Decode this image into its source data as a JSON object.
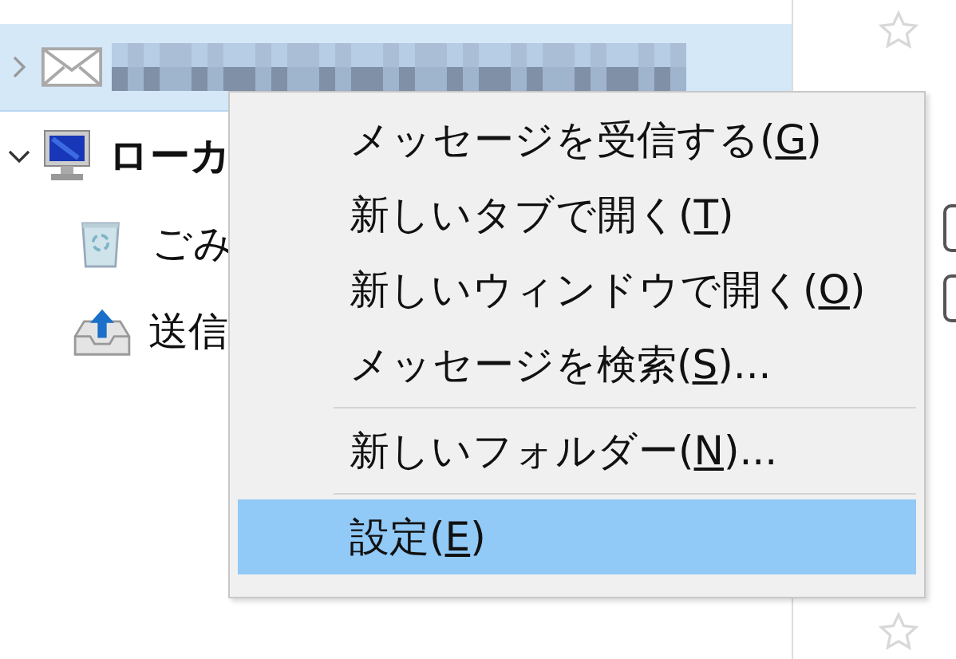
{
  "folder_tree": [
    {
      "kind": "account",
      "expanded": false,
      "selected": true
    },
    {
      "kind": "local",
      "label": "ローカ",
      "expanded": true,
      "selected": false,
      "children": [
        {
          "kind": "trash",
          "label": "ごみ",
          "selected": false
        },
        {
          "kind": "outbox",
          "label": "送信",
          "selected": false
        }
      ]
    }
  ],
  "context_menu": {
    "items": [
      {
        "kind": "item",
        "label": "メッセージを受信する(",
        "key": "G",
        "suffix": ")",
        "selected": false
      },
      {
        "kind": "item",
        "label": "新しいタブで開く(",
        "key": "T",
        "suffix": ")",
        "selected": false
      },
      {
        "kind": "item",
        "label": "新しいウィンドウで開く(",
        "key": "O",
        "suffix": ")",
        "selected": false
      },
      {
        "kind": "item",
        "label": "メッセージを検索(",
        "key": "S",
        "suffix": ")...",
        "selected": false
      },
      {
        "kind": "separator"
      },
      {
        "kind": "item",
        "label": "新しいフォルダー(",
        "key": "N",
        "suffix": ")...",
        "selected": false
      },
      {
        "kind": "separator"
      },
      {
        "kind": "item",
        "label": "設定(",
        "key": "E",
        "suffix": ")",
        "selected": true
      }
    ]
  }
}
